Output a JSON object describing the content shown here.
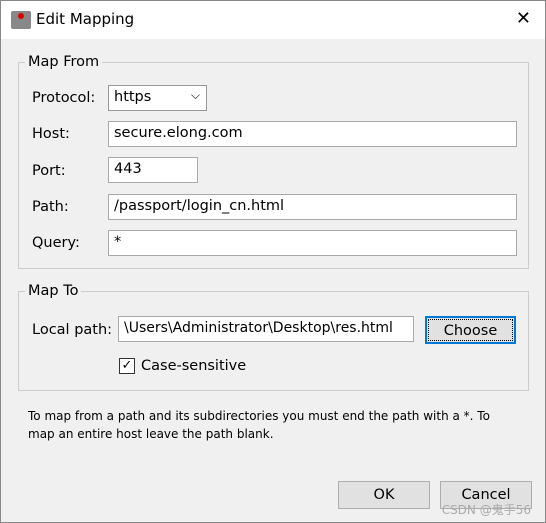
{
  "window": {
    "title": "Edit Mapping",
    "close": "✕"
  },
  "map_from": {
    "legend": "Map From",
    "protocol_label": "Protocol:",
    "protocol_value": "https",
    "host_label": "Host:",
    "host_value": "secure.elong.com",
    "port_label": "Port:",
    "port_value": "443",
    "path_label": "Path:",
    "path_value": "/passport/login_cn.html",
    "query_label": "Query:",
    "query_value": "*"
  },
  "map_to": {
    "legend": "Map To",
    "local_path_label": "Local path:",
    "local_path_value": "\\Users\\Administrator\\Desktop\\res.html",
    "choose": "Choose",
    "case_sensitive": "Case-sensitive",
    "case_sensitive_checked": true
  },
  "note": "To map from a path and its subdirectories you must end the path with a *. To map an entire host leave the path blank.",
  "buttons": {
    "ok": "OK",
    "cancel": "Cancel"
  },
  "watermark": "CSDN @鬼手56"
}
